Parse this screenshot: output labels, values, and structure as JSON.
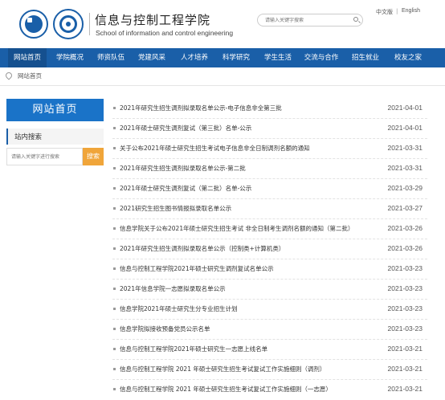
{
  "header": {
    "title_cn": "信息与控制工程学院",
    "title_en": "School of information and control engineering",
    "search_placeholder": "请输入关键字搜索",
    "lang_cn": "中文版",
    "lang_sep": "|",
    "lang_en": "English"
  },
  "nav": {
    "items": [
      "网站首页",
      "学院概况",
      "师资队伍",
      "党建风采",
      "人才培养",
      "科学研究",
      "学生生活",
      "交流与合作",
      "招生就业",
      "校友之家"
    ]
  },
  "breadcrumb": {
    "text": "网站首页"
  },
  "sidebar": {
    "title": "网站首页",
    "search_label": "站内搜索",
    "search_placeholder": "请输入关键字进行搜索",
    "search_button": "搜索"
  },
  "news": [
    {
      "title": "2021年研究生招生调剂拟录取名单公示-电子信息非全第三批",
      "date": "2021-04-01"
    },
    {
      "title": "2021年硕士研究生调剂复试（第三批）名单-公示",
      "date": "2021-04-01"
    },
    {
      "title": "关于公布2021年硕士研究生招生考试电子信息非全日制调剂名额的通知",
      "date": "2021-03-31"
    },
    {
      "title": "2021年研究生招生调剂拟录取名单公示-第二批",
      "date": "2021-03-31"
    },
    {
      "title": "2021年硕士研究生调剂复试（第二批）名单-公示",
      "date": "2021-03-29"
    },
    {
      "title": "2021研究生招生图书情报拟录取名单公示",
      "date": "2021-03-27"
    },
    {
      "title": "信息学院关于公布2021年硕士研究生招生考试 非全日制考生调剂名额的通知（第二批）",
      "date": "2021-03-26"
    },
    {
      "title": "2021年研究生招生调剂拟录取名单公示（控制类+计算机类）",
      "date": "2021-03-26"
    },
    {
      "title": "信息与控制工程学院2021年硕士研究生调剂复试名单公示",
      "date": "2021-03-23"
    },
    {
      "title": "2021年信息学院一志愿拟录取名单公示",
      "date": "2021-03-23"
    },
    {
      "title": "信息学院2021年硕士研究生分专业招生计划",
      "date": "2021-03-23"
    },
    {
      "title": "信息学院拟接收预备党员公示名单",
      "date": "2021-03-23"
    },
    {
      "title": "信息与控制工程学院2021年硕士研究生一志愿上线名单",
      "date": "2021-03-21"
    },
    {
      "title": "信息与控制工程学院 2021 年硕士研究生招生考试复试工作实施细则（调剂）",
      "date": "2021-03-21"
    },
    {
      "title": "信息与控制工程学院 2021 年硕士研究生招生考试复试工作实施细则（一志愿）",
      "date": "2021-03-21"
    }
  ],
  "colors": {
    "nav_bg": "#1a5fa8",
    "sidebar_title_bg": "#1a73c8",
    "search_button_bg": "#f0a53a"
  },
  "icons": {
    "search": "magnifier-icon",
    "location": "location-pin-icon"
  }
}
